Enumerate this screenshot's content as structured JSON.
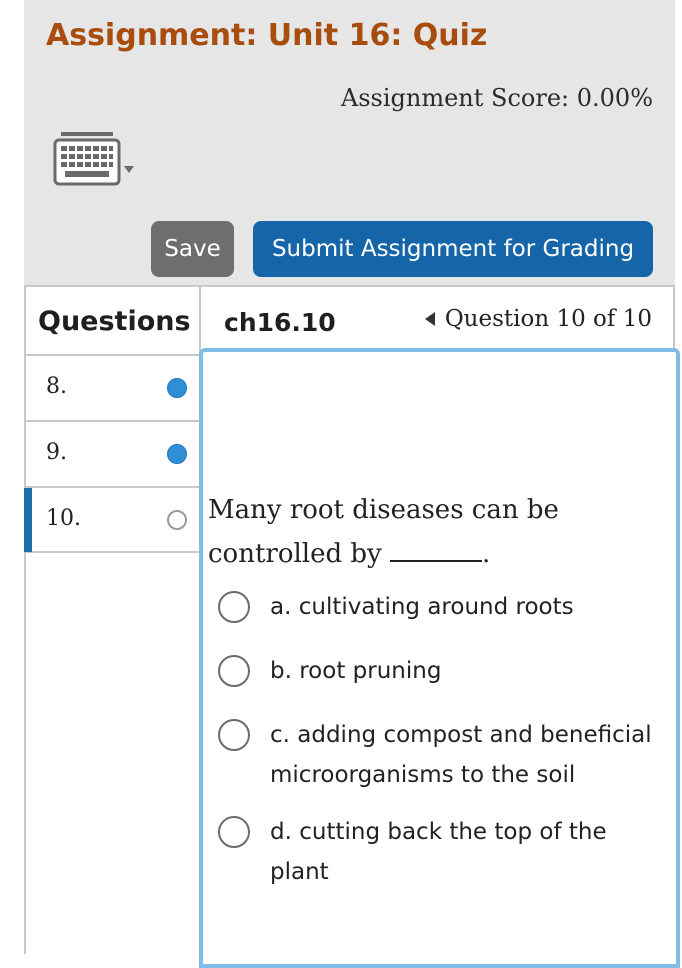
{
  "header": {
    "title": "Assignment: Unit 16: Quiz",
    "score": "Assignment Score: 0.00%",
    "keyboard_icon": "keyboard-icon",
    "save_label": "Save",
    "submit_label": "Submit Assignment for Grading"
  },
  "questions_panel": {
    "heading": "Questions",
    "items": [
      {
        "number": "8.",
        "status": "answered"
      },
      {
        "number": "9.",
        "status": "answered"
      },
      {
        "number": "10.",
        "status": "unanswered",
        "active": true
      }
    ]
  },
  "question": {
    "id": "ch16.10",
    "position": "Question 10 of 10",
    "text_before": "Many root diseases can be controlled by ",
    "text_after": ".",
    "options": [
      {
        "label": "a. cultivating around roots"
      },
      {
        "label": "b. root pruning"
      },
      {
        "label": "c. adding compost and beneficial microorganisms to the soil"
      },
      {
        "label": "d. cutting back the top of the plant"
      }
    ]
  },
  "colors": {
    "title": "#a84d0e",
    "save_button": "#6e6e6e",
    "submit_button": "#1565a8",
    "answered_dot": "#2e8fd8",
    "active_indicator": "#1d6fa8",
    "panel_border": "#7fbde6"
  }
}
